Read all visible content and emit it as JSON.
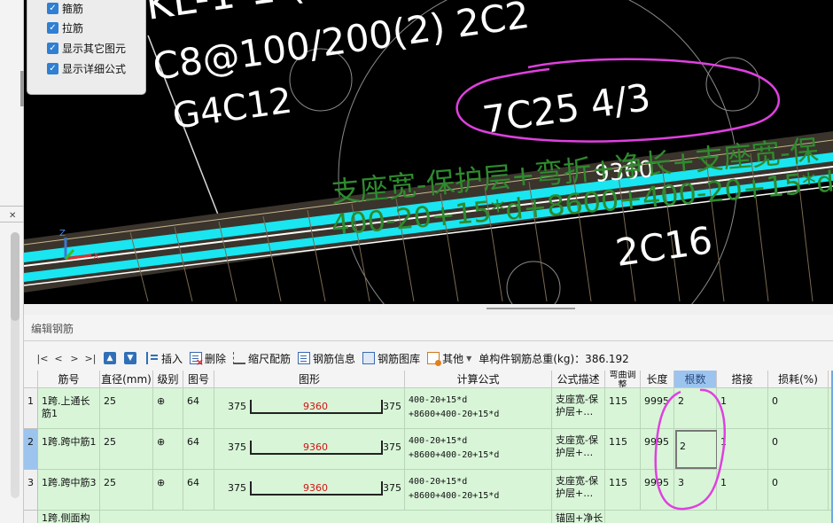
{
  "options_panel": {
    "items": [
      {
        "label": "箍筋",
        "checked": true
      },
      {
        "label": "拉筋",
        "checked": true
      },
      {
        "label": "显示其它图元",
        "checked": true
      },
      {
        "label": "显示详细公式",
        "checked": true
      }
    ]
  },
  "viewport": {
    "labels": {
      "beam_id": "KL-1-1 (",
      "stirrup": "C8@100/200(2) 2C2",
      "waist": "G4C12",
      "top_bar": "7C25 4/3",
      "length": "9360",
      "formula_line1": "支座宽-保护层+弯折+净长+支座宽-保",
      "formula_line2": "400-20+15*d+8600+400-20+15*d",
      "bottom_bar": "2C16"
    },
    "axis_labels": {
      "z": "Z",
      "x": "X"
    },
    "colors": {
      "background": "#000000",
      "bar_cyan": "#19e6f0",
      "formula_green": "#2e8b2e",
      "annotation": "#e040e0"
    }
  },
  "editor": {
    "title": "编辑钢筋",
    "nav": [
      "|<",
      "<",
      ">",
      ">|"
    ],
    "toolbar": {
      "insert": "插入",
      "delete": "删除",
      "scale_rebar": "缩尺配筋",
      "rebar_info": "钢筋信息",
      "rebar_library": "钢筋图库",
      "other": "其他",
      "total_weight": "单构件钢筋总重(kg)：386.192"
    },
    "columns": [
      "筋号",
      "直径(mm)",
      "级别",
      "图号",
      "图形",
      "计算公式",
      "公式描述",
      "弯曲调整",
      "长度",
      "根数",
      "搭接",
      "损耗(%)"
    ],
    "rows": [
      {
        "no": "1",
        "name": "1跨.上通长筋1",
        "dia": "25",
        "grade": "⊕",
        "fig": "64",
        "left": "375",
        "mid": "9360",
        "right": "375",
        "f1": "400-20+15*d",
        "f2": "+8600+400-20+15*d",
        "desc": "支座宽-保护层+…",
        "bend": "115",
        "len": "9995",
        "count": "2",
        "lap": "1",
        "loss": "0"
      },
      {
        "no": "2",
        "name": "1跨.跨中筋1",
        "dia": "25",
        "grade": "⊕",
        "fig": "64",
        "left": "375",
        "mid": "9360",
        "right": "375",
        "f1": "400-20+15*d",
        "f2": "+8600+400-20+15*d",
        "desc": "支座宽-保护层+…",
        "bend": "115",
        "len": "9995",
        "count": "2",
        "lap": "1",
        "loss": "0"
      },
      {
        "no": "3",
        "name": "1跨.跨中筋3",
        "dia": "25",
        "grade": "⊕",
        "fig": "64",
        "left": "375",
        "mid": "9360",
        "right": "375",
        "f1": "400-20+15*d",
        "f2": "+8600+400-20+15*d",
        "desc": "支座宽-保护层+…",
        "bend": "115",
        "len": "9995",
        "count": "3",
        "lap": "1",
        "loss": "0"
      },
      {
        "name": "1跨.侧面构",
        "desc": "锚固+净长"
      }
    ]
  }
}
